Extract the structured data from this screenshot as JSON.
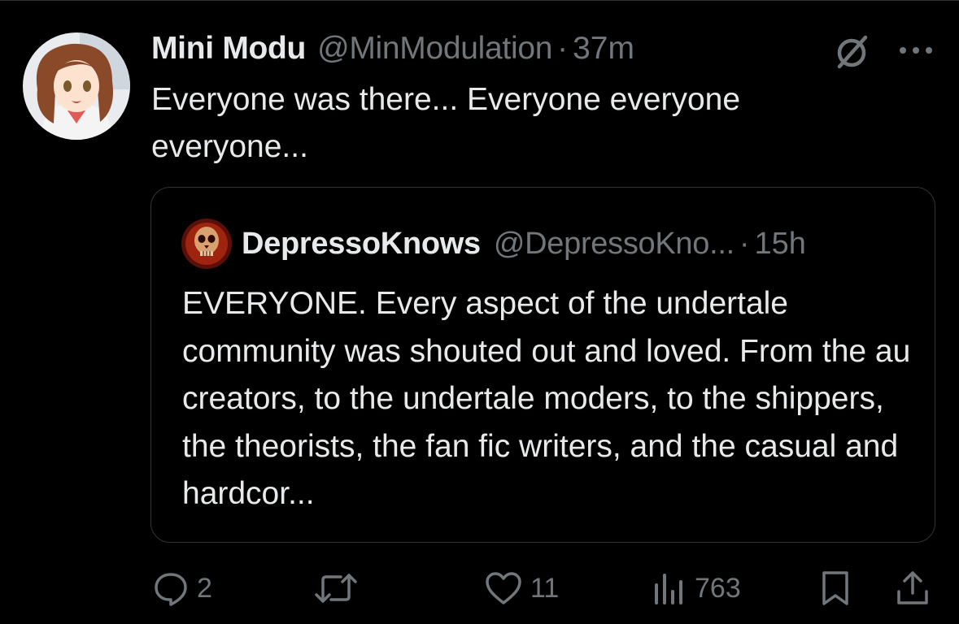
{
  "tweet": {
    "display_name": "Mini Modu",
    "handle": "@MinModulation",
    "separator": "·",
    "time": "37m",
    "text": "Everyone was there... Everyone everyone everyone...",
    "avatar_icon": "anime-girl-avatar",
    "grok_icon": "grok-icon",
    "more_icon": "more-options-icon"
  },
  "quote": {
    "display_name": "DepressoKnows",
    "handle": "@DepressoKno...",
    "separator": "·",
    "time": "15h",
    "text": "EVERYONE. Every aspect of the undertale community was shouted out and loved. From the au creators, to the undertale moders, to the shippers, the theorists, the fan fic writers, and the casual and hardcor...",
    "avatar_icon": "red-skull-avatar"
  },
  "actions": {
    "replies": "2",
    "reposts": "",
    "likes": "11",
    "views": "763"
  },
  "colors": {
    "background": "#000000",
    "text": "#e7e9ea",
    "secondary": "#71767b",
    "border": "#2f3336"
  }
}
